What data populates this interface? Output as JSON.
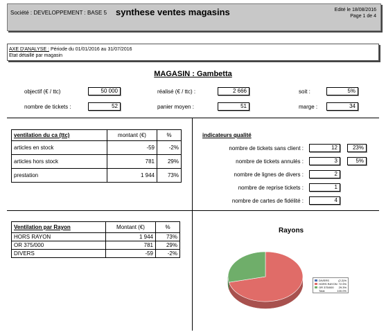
{
  "header": {
    "company": "Société : DEVELOPPEMENT : BASE 5",
    "title": "synthese ventes magasins",
    "edit_date": "Edité le 18/08/2016",
    "page": "Page 1 de 4"
  },
  "axis": {
    "label": "AXE D'ANALYSE :",
    "period": " Période du 01/01/2016 au 31/07/2016",
    "detail": "Etat détaillé par magasin"
  },
  "store": {
    "title": "MAGASIN : Gambetta"
  },
  "summary": {
    "objectif_label": "objectif (€ / ttc)",
    "objectif_value": "50 000",
    "realise_label": "réalisé (€ / ttc) :",
    "realise_value": "2 666",
    "soit_label": "soit :",
    "soit_value": "5%",
    "tickets_label": "nombre de tickets :",
    "tickets_value": "52",
    "panier_label": "panier moyen :",
    "panier_value": "51",
    "marge_label": "marge :",
    "marge_value": "34"
  },
  "ventilation_ca": {
    "title": "ventilation du ca (ttc)",
    "col_montant": "montant (€)",
    "col_pct": "%",
    "rows": [
      {
        "label": "articles en stock",
        "montant": "-59",
        "pct": "-2%"
      },
      {
        "label": "articles hors stock",
        "montant": "781",
        "pct": "29%"
      },
      {
        "label": "prestation",
        "montant": "1 944",
        "pct": "73%"
      }
    ]
  },
  "indicateurs": {
    "title": "indicateurs qualité",
    "rows": [
      {
        "label": "nombre de tickets sans client :",
        "value": "12",
        "pct": "23%"
      },
      {
        "label": "nombre de tickets annulés :",
        "value": "3",
        "pct": "5%"
      },
      {
        "label": "nombre de lignes de divers :",
        "value": "2",
        "pct": ""
      },
      {
        "label": "nombre de reprise tickets :",
        "value": "1",
        "pct": ""
      },
      {
        "label": "nombre de cartes de fidélité :",
        "value": "4",
        "pct": ""
      }
    ]
  },
  "ventilation_rayon": {
    "title": "Ventilation par Rayon",
    "col_montant": "Montant (€)",
    "col_pct": "%",
    "rows": [
      {
        "label": "HORS RAYON",
        "montant": "1 944",
        "pct": "73%"
      },
      {
        "label": "OR 375/000",
        "montant": "781",
        "pct": "29%"
      },
      {
        "label": "DIVERS",
        "montant": "-59",
        "pct": "-2%"
      }
    ]
  },
  "chart_data": {
    "type": "pie",
    "title": "Rayons",
    "categories": [
      "DIVERS",
      "HORS RAYON",
      "OR 375/000"
    ],
    "values": [
      -2.2,
      72.9,
      29.3
    ],
    "labels": [
      "(2.2)%",
      "72.9%",
      "29.3%"
    ],
    "total_label": "Total",
    "total_value": "100.0%",
    "colors": [
      "#4a6fb3",
      "#e06c68",
      "#6fae6a"
    ],
    "legend_position": "right"
  }
}
